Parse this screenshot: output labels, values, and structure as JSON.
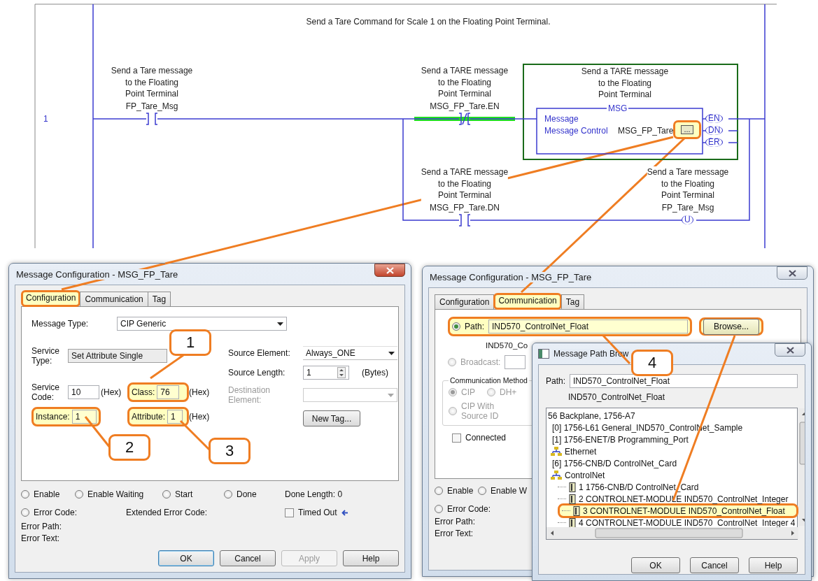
{
  "ladder": {
    "rung_number": "1",
    "rung_comment": "Send a Tare Command for Scale 1 on the Floating Point Terminal.",
    "instructions": [
      {
        "kind": "xic",
        "description": [
          "Send a Tare message",
          "to the Floating",
          "Point Terminal"
        ],
        "tag": "FP_Tare_Msg",
        "energized": false
      },
      {
        "kind": "xio",
        "description": [
          "Send a TARE message",
          "to the Floating",
          "Point Terminal"
        ],
        "tag": "MSG_FP_Tare.EN",
        "energized": true
      },
      {
        "kind": "msg",
        "description": [
          "Send a TARE message",
          "to the Floating",
          "Point Terminal"
        ],
        "title": "MSG",
        "type_label": "Message",
        "control_label": "Message Control",
        "control_tag": "MSG_FP_Tare",
        "browse_label": "...",
        "highlighted": true,
        "outputs": [
          "EN",
          "DN",
          "ER"
        ]
      },
      {
        "kind": "xic",
        "description": [
          "Send a TARE message",
          "to the Floating",
          "Point Terminal"
        ],
        "tag": "MSG_FP_Tare.DN",
        "energized": false
      },
      {
        "kind": "otu",
        "description": [
          "Send a Tare message",
          "to the Floating",
          "Point Terminal"
        ],
        "tag": "FP_Tare_Msg",
        "coil": "U"
      }
    ]
  },
  "config_dialog": {
    "title": "Message Configuration - MSG_FP_Tare",
    "tabs": [
      {
        "label": "Configuration",
        "selected": true,
        "highlighted": true
      },
      {
        "label": "Communication",
        "selected": false,
        "highlighted": false
      },
      {
        "label": "Tag",
        "selected": false,
        "highlighted": false
      }
    ],
    "message_type": {
      "label": "Message Type:",
      "value": "CIP Generic"
    },
    "service_type": {
      "label": "Service Type:",
      "value": "Set Attribute Single"
    },
    "service_code": {
      "label": "Service Code:",
      "value": "10",
      "unit": "(Hex)"
    },
    "class": {
      "label": "Class:",
      "value": "76",
      "unit": "(Hex)",
      "highlighted": true
    },
    "instance": {
      "label": "Instance:",
      "value": "1",
      "highlighted": true
    },
    "attribute": {
      "label": "Attribute:",
      "value": "1",
      "unit": "(Hex)",
      "highlighted": true
    },
    "source_element": {
      "label": "Source Element:",
      "value": "Always_ONE"
    },
    "source_length": {
      "label": "Source Length:",
      "value": "1",
      "unit": "(Bytes)"
    },
    "destination_element": {
      "label": "Destination Element:",
      "disabled": true
    },
    "new_tag_button": "New Tag...",
    "status": [
      {
        "label": "Enable",
        "on": false
      },
      {
        "label": "Enable Waiting",
        "on": false
      },
      {
        "label": "Start",
        "on": false
      },
      {
        "label": "Done",
        "on": false
      }
    ],
    "done_length": "Done Length: 0",
    "error_code": {
      "label": "Error Code:",
      "on": false
    },
    "extended_error_code": "Extended Error Code:",
    "timed_out": {
      "label": "Timed Out",
      "checked": false
    },
    "error_path": "Error Path:",
    "error_text": "Error Text:",
    "buttons": [
      {
        "label": "OK",
        "disabled": false,
        "default": true
      },
      {
        "label": "Cancel",
        "disabled": false,
        "default": false
      },
      {
        "label": "Apply",
        "disabled": true,
        "default": false
      },
      {
        "label": "Help",
        "disabled": false,
        "default": false
      }
    ]
  },
  "comm_dialog": {
    "title": "Message Configuration - MSG_FP_Tare",
    "tabs": [
      {
        "label": "Configuration",
        "selected": false,
        "highlighted": false
      },
      {
        "label": "Communication",
        "selected": true,
        "highlighted": true
      },
      {
        "label": "Tag",
        "selected": false,
        "highlighted": false
      }
    ],
    "path": {
      "label": "Path:",
      "value": "IND570_ControlNet_Float",
      "selected": true,
      "highlighted": true
    },
    "browse_button": {
      "label": "Browse...",
      "highlighted": true
    },
    "path_resolved": "IND570_Co",
    "broadcast": {
      "label": "Broadcast:",
      "selected": false,
      "disabled": true
    },
    "method_group": {
      "label": "Communication Method",
      "options": [
        {
          "label": "CIP",
          "selected": true
        },
        {
          "label": "DH+",
          "selected": false
        },
        {
          "label": "CIP With Source ID",
          "selected": false
        }
      ]
    },
    "connected": {
      "label": "Connected",
      "checked": false
    },
    "status": [
      {
        "label": "Enable",
        "on": false
      },
      {
        "label": "Enable W",
        "on": false
      }
    ],
    "error_code": {
      "label": "Error Code:",
      "on": false
    },
    "error_path": "Error Path:",
    "error_text": "Error Text:"
  },
  "path_browser": {
    "title": "Message Path Brow",
    "path": {
      "label": "Path:",
      "value": "IND570_ControlNet_Float"
    },
    "resolved": "IND570_ControlNet_Float",
    "tree": [
      {
        "label": "56 Backplane, 1756-A7",
        "kind": "backplane",
        "selected": false,
        "children": [
          {
            "label": "[0] 1756-L61 General_IND570_ControlNet_Sample",
            "kind": "module",
            "selected": false
          },
          {
            "label": "[1] 1756-ENET/B Programming_Port",
            "kind": "module",
            "selected": false
          },
          {
            "label": "Ethernet",
            "kind": "network",
            "selected": false
          },
          {
            "label": "[6] 1756-CNB/D ControlNet_Card",
            "kind": "module",
            "selected": false
          },
          {
            "label": "ControlNet",
            "kind": "network",
            "selected": false,
            "children": [
              {
                "label": "1 1756-CNB/D ControlNet_Card",
                "kind": "device",
                "selected": false
              },
              {
                "label": "2 CONTROLNET-MODULE IND570_ControlNet_Integer",
                "kind": "device",
                "selected": false
              },
              {
                "label": "3 CONTROLNET-MODULE IND570_ControlNet_Float",
                "kind": "device",
                "selected": true
              },
              {
                "label": "4 CONTROLNET-MODULE IND570_ControlNet_Integer 4",
                "kind": "device",
                "selected": false
              }
            ]
          }
        ]
      }
    ],
    "buttons": [
      "OK",
      "Cancel",
      "Help"
    ]
  },
  "callouts": [
    {
      "label": "1"
    },
    {
      "label": "2"
    },
    {
      "label": "3"
    },
    {
      "label": "4"
    }
  ]
}
